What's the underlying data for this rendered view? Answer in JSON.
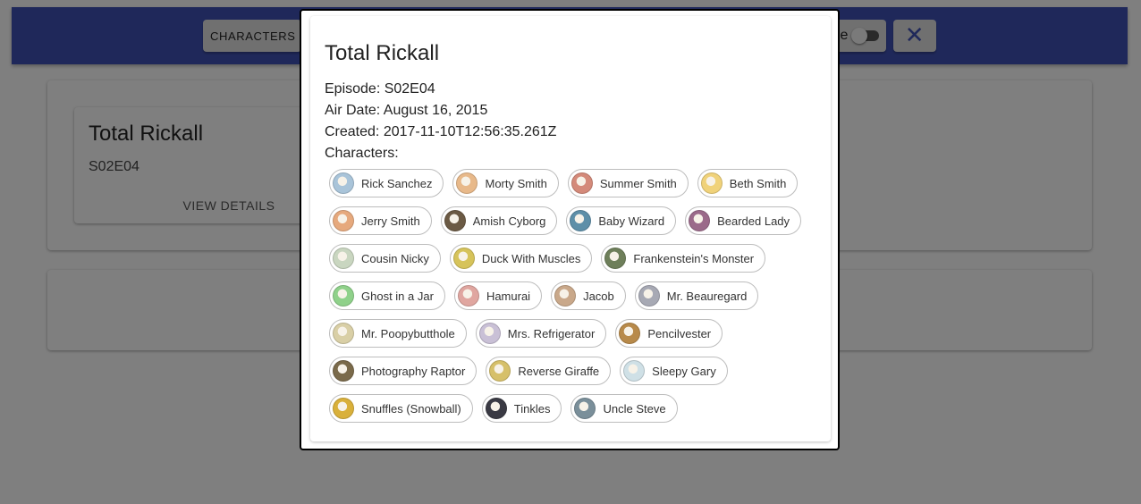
{
  "appbar": {
    "characters_label": "CHARACTERS",
    "theme_label": "e",
    "close_icon": "close-icon"
  },
  "episode_card": {
    "title": "Total Rickall",
    "code": "S02E04",
    "view_label": "VIEW DETAILS"
  },
  "modal": {
    "title": "Total Rickall",
    "episode_line": "Episode: S02E04",
    "air_date_line": "Air Date: August 16, 2015",
    "created_line": "Created: 2017-11-10T12:56:35.261Z",
    "characters_heading": "Characters:",
    "characters": [
      {
        "name": "Rick Sanchez",
        "color": "#a9c4d9"
      },
      {
        "name": "Morty Smith",
        "color": "#e8b98a"
      },
      {
        "name": "Summer Smith",
        "color": "#d48a7a"
      },
      {
        "name": "Beth Smith",
        "color": "#f0d27a"
      },
      {
        "name": "Jerry Smith",
        "color": "#e6a97d"
      },
      {
        "name": "Amish Cyborg",
        "color": "#6b5a44"
      },
      {
        "name": "Baby Wizard",
        "color": "#5e8fa8"
      },
      {
        "name": "Bearded Lady",
        "color": "#9b6a8a"
      },
      {
        "name": "Cousin Nicky",
        "color": "#c9d6c0"
      },
      {
        "name": "Duck With Muscles",
        "color": "#d6c35a"
      },
      {
        "name": "Frankenstein's Monster",
        "color": "#6e7f5a"
      },
      {
        "name": "Ghost in a Jar",
        "color": "#8fd18a"
      },
      {
        "name": "Hamurai",
        "color": "#e0a6a0"
      },
      {
        "name": "Jacob",
        "color": "#c9a88a"
      },
      {
        "name": "Mr. Beauregard",
        "color": "#a7a9b4"
      },
      {
        "name": "Mr. Poopybutthole",
        "color": "#d9cfa6"
      },
      {
        "name": "Mrs. Refrigerator",
        "color": "#c9c0d6"
      },
      {
        "name": "Pencilvester",
        "color": "#b88a4a"
      },
      {
        "name": "Photography Raptor",
        "color": "#7a6a4a"
      },
      {
        "name": "Reverse Giraffe",
        "color": "#d6c06a"
      },
      {
        "name": "Sleepy Gary",
        "color": "#cfe0e6"
      },
      {
        "name": "Snuffles (Snowball)",
        "color": "#d9b03a"
      },
      {
        "name": "Tinkles",
        "color": "#3a3a44"
      },
      {
        "name": "Uncle Steve",
        "color": "#7a8f9a"
      }
    ]
  }
}
